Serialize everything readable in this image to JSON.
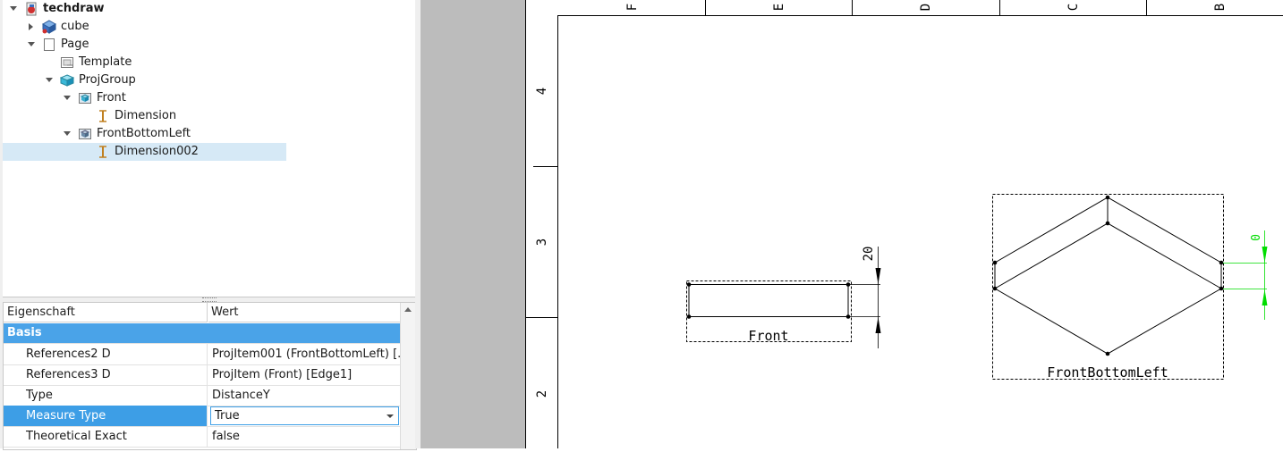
{
  "tree": {
    "items": [
      {
        "label": "techdraw",
        "icon": "document-icon"
      },
      {
        "label": "cube",
        "icon": "cube-icon"
      },
      {
        "label": "Page",
        "icon": "page-icon"
      },
      {
        "label": "Template",
        "icon": "template-icon"
      },
      {
        "label": "ProjGroup",
        "icon": "projgroup-icon"
      },
      {
        "label": "Front",
        "icon": "view-icon"
      },
      {
        "label": "Dimension",
        "icon": "dimension-icon"
      },
      {
        "label": "FrontBottomLeft",
        "icon": "view-icon"
      },
      {
        "label": "Dimension002",
        "icon": "dimension-icon"
      }
    ]
  },
  "properties": {
    "headers": {
      "property": "Eigenschaft",
      "value": "Wert"
    },
    "group": "Basis",
    "rows": [
      {
        "key": "References2 D",
        "value": "ProjItem001 (FrontBottomLeft) [..."
      },
      {
        "key": "References3 D",
        "value": "ProjItem (Front) [Edge1]"
      },
      {
        "key": "Type",
        "value": "DistanceY"
      },
      {
        "key": "Measure Type",
        "value": "True"
      },
      {
        "key": "Theoretical Exact",
        "value": "false"
      }
    ]
  },
  "drawing": {
    "columns": [
      "F",
      "E",
      "D",
      "C",
      "B"
    ],
    "rows": [
      "4",
      "3",
      "2"
    ],
    "front_label": "Front",
    "front_dimension": "20",
    "fbl_label": "FrontBottomLeft",
    "fbl_dimension": "0",
    "colors": {
      "dimension_selected": "#00dd00",
      "frame": "#000000"
    }
  }
}
